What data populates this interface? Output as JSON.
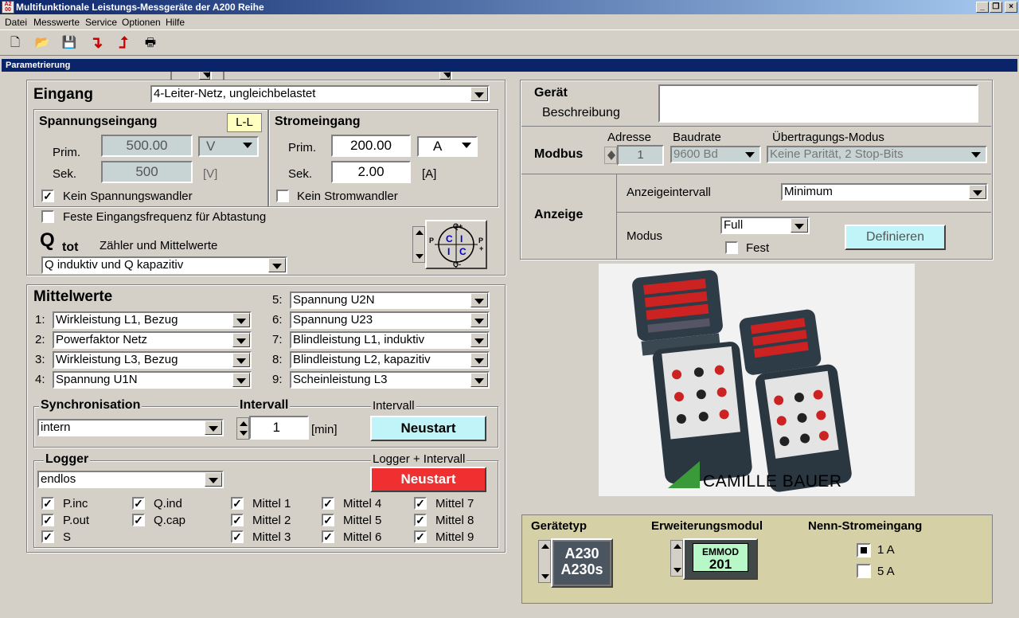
{
  "window": {
    "title": "Multifunktionale Leistungs-Messgeräte der A200 Reihe"
  },
  "menu": [
    "Datei",
    "Messwerte",
    "Service",
    "Optionen",
    "Hilfe"
  ],
  "panel_title": "Parametrierung",
  "eingang": {
    "title": "Eingang",
    "mode": "4-Leiter-Netz, ungleichbelastet",
    "spannung_title": "Spannungseingang",
    "ll_badge": "L-L",
    "prim_label": "Prim.",
    "sek_label": "Sek.",
    "u_prim": "500.00",
    "u_sek": "500",
    "u_unit": "V",
    "u_sek_unit": "[V]",
    "kein_spannungswandler": "Kein Spannungswandler",
    "strom_title": "Stromeingang",
    "i_prim": "200.00",
    "i_sek": "2.00",
    "i_unit": "A",
    "i_sek_unit": "[A]",
    "kein_stromwandler": "Kein Stromwandler",
    "feste_freq": "Feste Eingangsfrequenz für Abtastung",
    "qtot_q": "Q",
    "qtot_sub": "tot",
    "qtot_label": "Zähler und  Mittelwerte",
    "qtot_value": "Q induktiv und Q kapazitiv",
    "quad": {
      "top": "Q+",
      "bottom": "Q-",
      "left": "P",
      "right": "P",
      "plus": "+",
      "c1": "C",
      "i1": "I",
      "i2": "I",
      "c2": "C"
    }
  },
  "mittelwerte": {
    "title": "Mittelwerte",
    "items": [
      {
        "n": "1:",
        "v": "Wirkleistung L1, Bezug"
      },
      {
        "n": "2:",
        "v": "Powerfaktor Netz"
      },
      {
        "n": "3:",
        "v": "Wirkleistung L3, Bezug"
      },
      {
        "n": "4:",
        "v": "Spannung U1N"
      },
      {
        "n": "5:",
        "v": "Spannung U2N"
      },
      {
        "n": "6:",
        "v": "Spannung U23"
      },
      {
        "n": "7:",
        "v": "Blindleistung L1, induktiv"
      },
      {
        "n": "8:",
        "v": "Blindleistung L2, kapazitiv"
      },
      {
        "n": "9:",
        "v": "Scheinleistung L3"
      }
    ]
  },
  "sync": {
    "title": "Synchronisation",
    "value": "intern",
    "intervall_title": "Intervall",
    "intervall_value": "1",
    "unit": "[min]",
    "intervall_label2": "Intervall",
    "neustart": "Neustart"
  },
  "logger": {
    "title": "Logger",
    "value": "endlos",
    "label2": "Logger + Intervall",
    "neustart": "Neustart",
    "checks": [
      [
        "P.inc",
        "Q.ind",
        "Mittel 1",
        "Mittel 4",
        "Mittel 7"
      ],
      [
        "P.out",
        "Q.cap",
        "Mittel 2",
        "Mittel 5",
        "Mittel 8"
      ],
      [
        "S",
        "",
        "Mittel 3",
        "Mittel 6",
        "Mittel 9"
      ]
    ]
  },
  "geraet": {
    "title": "Gerät",
    "beschreibung_label": "Beschreibung",
    "beschreibung_value": "",
    "modbus": "Modbus",
    "adresse_label": "Adresse",
    "adresse": "1",
    "baudrate_label": "Baudrate",
    "baudrate": "9600 Bd",
    "modus_label": "Übertragungs-Modus",
    "modus": "Keine Parität, 2 Stop-Bits",
    "anzeige": "Anzeige",
    "anzeigeintervall_label": "Anzeigeintervall",
    "anzeigeintervall": "Minimum",
    "modus2_label": "Modus",
    "modus2": "Full",
    "fest": "Fest",
    "definieren": "Definieren"
  },
  "brand": {
    "name": "CAMILLE BAUER"
  },
  "bottom": {
    "geraetetyp_label": "Gerätetyp",
    "geraetetyp_1": "A230",
    "geraetetyp_2": "A230s",
    "erweiterung_label": "Erweiterungsmodul",
    "emmod": "EMMOD",
    "emmod_num": "201",
    "nenn_label": "Nenn-Stromeingang",
    "opt1": "1 A",
    "opt2": "5 A"
  }
}
